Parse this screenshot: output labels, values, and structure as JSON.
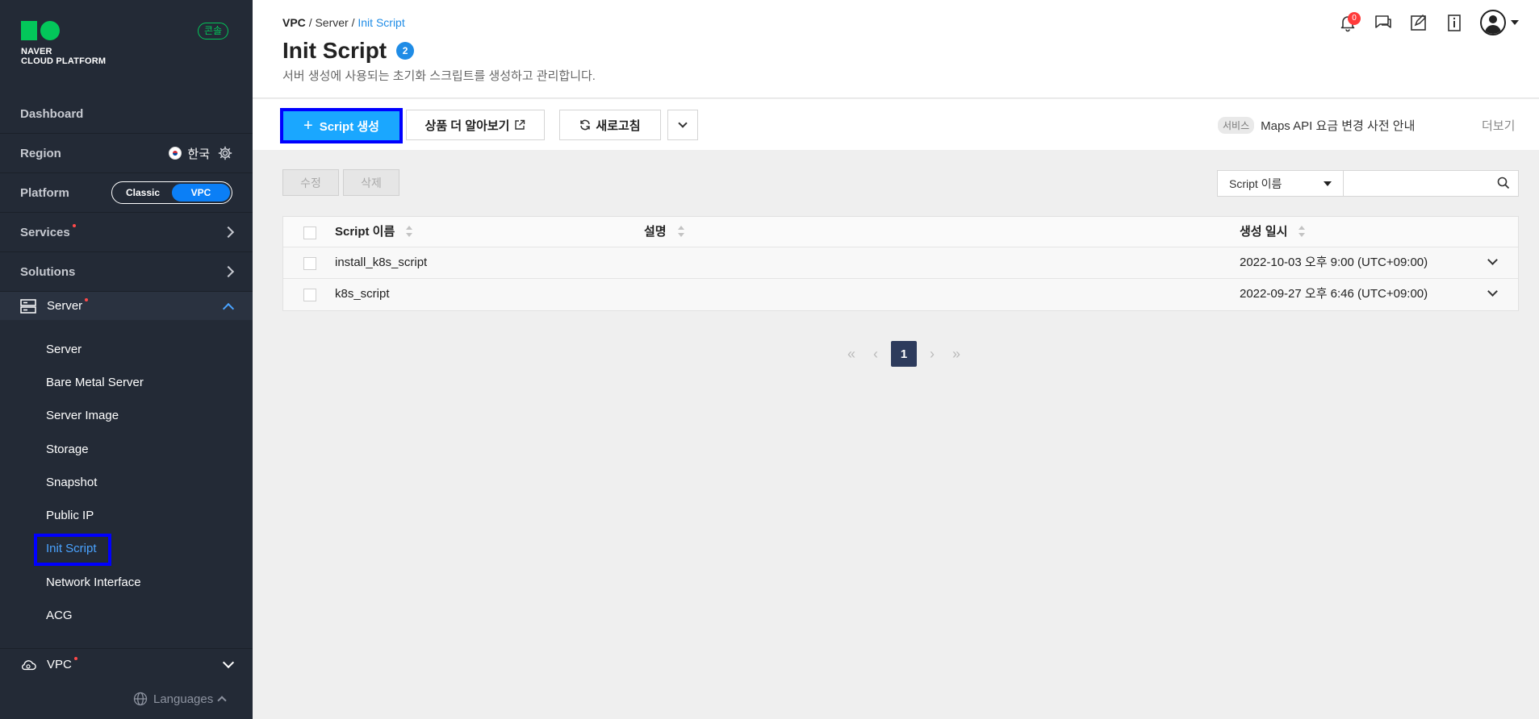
{
  "brand": {
    "line1": "NAVER",
    "line2": "CLOUD PLATFORM",
    "console_badge": "콘솔"
  },
  "sidebar": {
    "dashboard": "Dashboard",
    "region": {
      "label": "Region",
      "value": "한국"
    },
    "platform": {
      "label": "Platform",
      "options": [
        "Classic",
        "VPC"
      ],
      "selected": "VPC"
    },
    "services": "Services",
    "solutions": "Solutions",
    "server_section": "Server",
    "server_items": [
      "Server",
      "Bare Metal Server",
      "Server Image",
      "Storage",
      "Snapshot",
      "Public IP",
      "Init Script",
      "Network Interface",
      "ACG"
    ],
    "active_item": "Init Script",
    "vpc_section": "VPC",
    "languages": "Languages"
  },
  "header": {
    "breadcrumb": {
      "root": "VPC",
      "mid": "Server",
      "current": "Init Script",
      "sep": "/"
    },
    "title": "Init Script",
    "count": "2",
    "description": "서버 생성에 사용되는 초기화 스크립트를 생성하고 관리합니다.",
    "notification_count": "0"
  },
  "toolbar": {
    "create": "Script 생성",
    "learn_more": "상품 더 알아보기",
    "refresh": "새로고침",
    "notice_tag": "서비스",
    "notice_text": "Maps API 요금 변경 사전 안내",
    "more": "더보기"
  },
  "actions": {
    "edit": "수정",
    "delete": "삭제"
  },
  "search": {
    "field": "Script 이름",
    "value": ""
  },
  "table": {
    "columns": [
      "Script 이름",
      "설명",
      "생성 일시"
    ],
    "rows": [
      {
        "name": "install_k8s_script",
        "description": "",
        "created": "2022-10-03 오후 9:00 (UTC+09:00)"
      },
      {
        "name": "k8s_script",
        "description": "",
        "created": "2022-09-27 오후 6:46 (UTC+09:00)"
      }
    ]
  },
  "pagination": {
    "current": "1"
  },
  "colors": {
    "sidebar_bg": "#232a36",
    "accent_blue": "#1aa7ff",
    "brand_green": "#03c75a",
    "active_link": "#4aa3ff"
  }
}
